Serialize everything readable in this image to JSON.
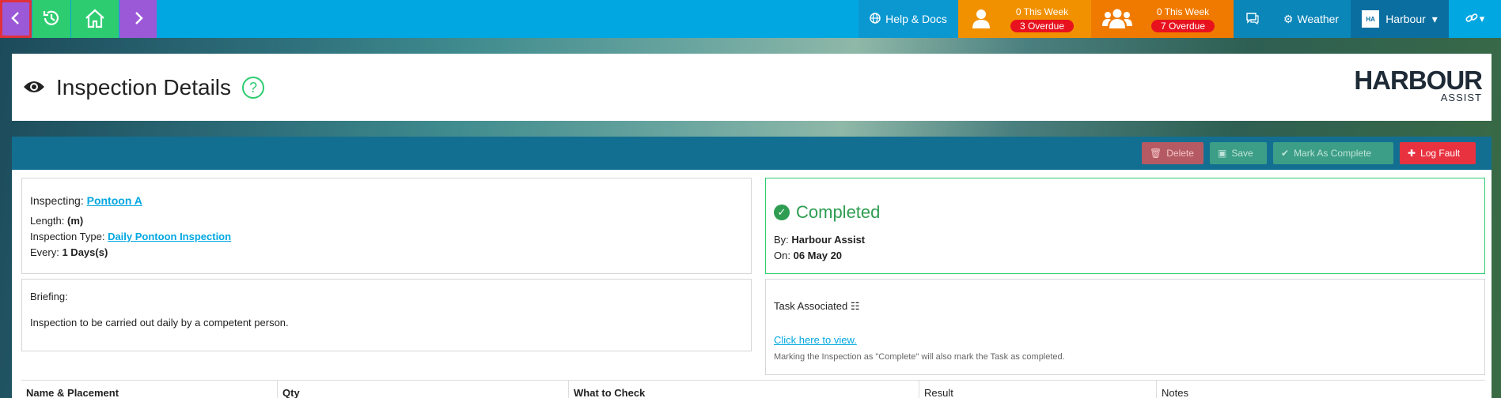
{
  "topbar": {
    "help_label": "Help & Docs",
    "user_this_week": "0 This Week",
    "user_overdue": "3 Overdue",
    "team_this_week": "0 This Week",
    "team_overdue": "7 Overdue",
    "weather_label": "Weather",
    "harbour_label": "Harbour",
    "icons": [
      "back-arrow-icon",
      "history-icon",
      "home-icon",
      "forward-arrow-icon",
      "globe-icon",
      "user-icon",
      "users-icon",
      "chat-icon",
      "gear-icon",
      "harbour-logo-icon",
      "link-icon"
    ]
  },
  "header": {
    "title": "Inspection Details",
    "help_glyph": "?",
    "brand_main": "HARBOUR",
    "brand_sub": "ASSIST"
  },
  "toolbar": {
    "delete_label": "Delete",
    "save_label": "Save",
    "mark_complete_label": "Mark As Complete",
    "log_fault_label": "Log Fault"
  },
  "inspection": {
    "inspecting_label": "Inspecting:",
    "inspecting_value": "Pontoon A",
    "length_label": "Length:",
    "length_value": "(m)",
    "type_label": "Inspection Type:",
    "type_value": "Daily Pontoon Inspection",
    "every_label": "Every:",
    "every_value": "1 Days(s)"
  },
  "status": {
    "title": "Completed",
    "by_label": "By:",
    "by_value": "Harbour Assist",
    "on_label": "On:",
    "on_value": "06 May 20"
  },
  "briefing": {
    "label": "Briefing:",
    "text": "Inspection to be carried out daily by a competent person."
  },
  "task": {
    "label": "Task Associated",
    "link": "Click here to view.",
    "note": "Marking the Inspection as \"Complete\" will also mark the Task as completed."
  },
  "table": {
    "headers": [
      "Name & Placement",
      "Qty",
      "What to Check",
      "Result",
      "Notes"
    ]
  },
  "colors": {
    "topbar": "#00a7e1",
    "accent_green": "#2ecc71",
    "panel_head": "#136f92",
    "danger": "#e8323f"
  }
}
